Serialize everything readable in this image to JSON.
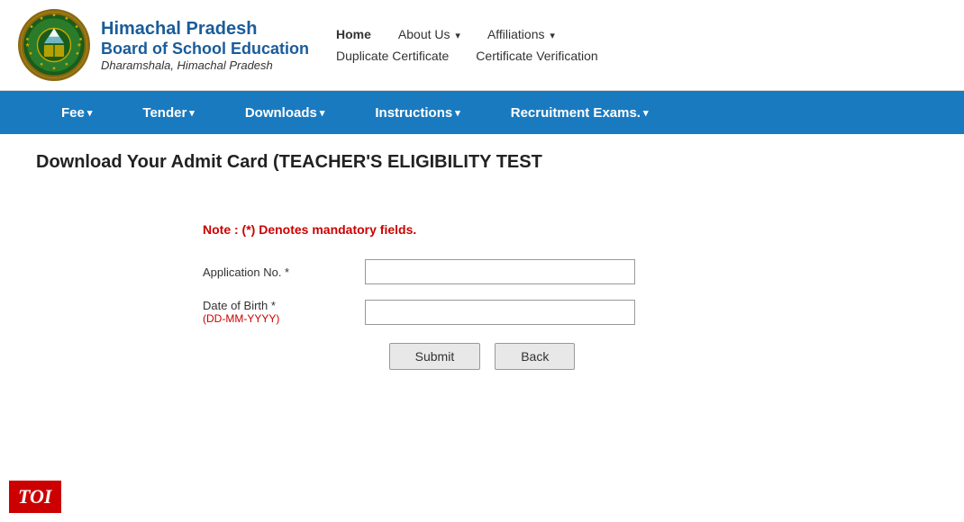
{
  "header": {
    "org_line1": "Himachal Pradesh",
    "org_line2": "Board of School Education",
    "org_subtitle": "Dharamshala, Himachal Pradesh"
  },
  "nav_row1": {
    "home": "Home",
    "about_us": "About Us",
    "about_us_arrow": "▾",
    "affiliations": "Affiliations",
    "affiliations_arrow": "▾"
  },
  "nav_row2": {
    "duplicate_certificate": "Duplicate Certificate",
    "certificate_verification": "Certificate Verification"
  },
  "blue_nav": {
    "fee": "Fee",
    "tender": "Tender",
    "downloads": "Downloads",
    "instructions": "Instructions",
    "recruitment_exams": "Recruitment Exams."
  },
  "main": {
    "page_title": "Download Your Admit Card (TEACHER'S ELIGIBILITY TEST"
  },
  "form": {
    "note": "Note  : (*) Denotes mandatory fields.",
    "application_label": "Application No. *",
    "dob_label": "Date of Birth *",
    "dob_hint": "(DD-MM-YYYY)",
    "application_placeholder": "",
    "dob_placeholder": "",
    "submit_btn": "Submit",
    "back_btn": "Back"
  },
  "toi": {
    "label": "TOI"
  }
}
